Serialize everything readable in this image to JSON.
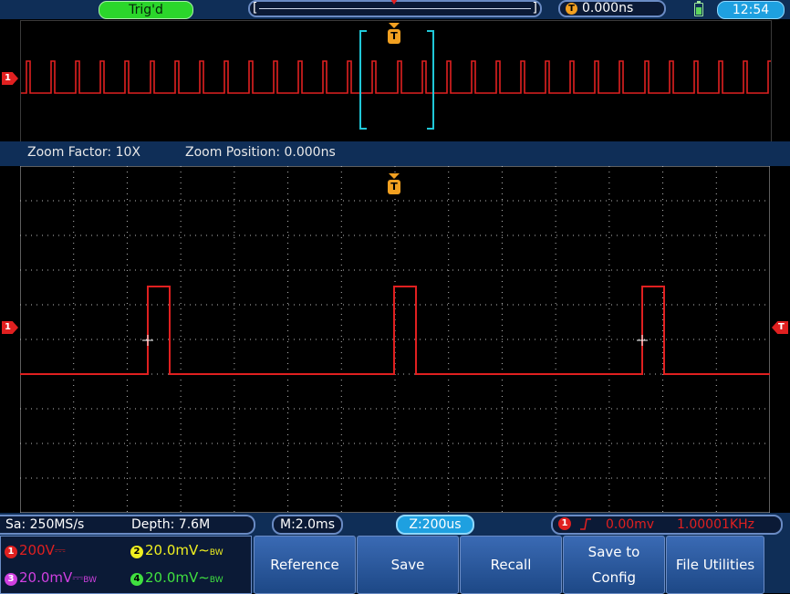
{
  "topbar": {
    "trigger_status": "Trig'd",
    "trigger_delay": "0.000ns",
    "clock": "12:54",
    "trigger_icon_letter": "T"
  },
  "zoom": {
    "factor": "Zoom Factor: 10X",
    "position": "Zoom Position: 0.000ns"
  },
  "markers": {
    "channel1": "1",
    "trigger": "T"
  },
  "status": {
    "sample_rate": "Sa: 250MS/s",
    "depth": "Depth: 7.6M",
    "main_timebase": "M:2.0ms",
    "zoom_timebase": "Z:200us",
    "trigger_channel": "1",
    "trigger_level": "0.00mv",
    "frequency": "1.00001KHz"
  },
  "channels": [
    {
      "num": "1",
      "scale": "200V",
      "coupling": "⎓",
      "bw": "",
      "color": "#e02020"
    },
    {
      "num": "2",
      "scale": "20.0mV",
      "coupling": "∼",
      "bw": "BW",
      "color": "#f0f020"
    },
    {
      "num": "3",
      "scale": "20.0mV",
      "coupling": "⎓",
      "bw": "BW",
      "color": "#d040e0"
    },
    {
      "num": "4",
      "scale": "20.0mV",
      "coupling": "∼",
      "bw": "BW",
      "color": "#40e040"
    }
  ],
  "menu": {
    "reference": "Reference",
    "save": "Save",
    "recall": "Recall",
    "save_to_config_1": "Save to",
    "save_to_config_2": "Config",
    "file_utilities": "File Utilities"
  },
  "colors": {
    "trace": "#e02020",
    "trigger": "#f2a020",
    "window": "#20c8d8",
    "panel": "#0f2e57"
  }
}
